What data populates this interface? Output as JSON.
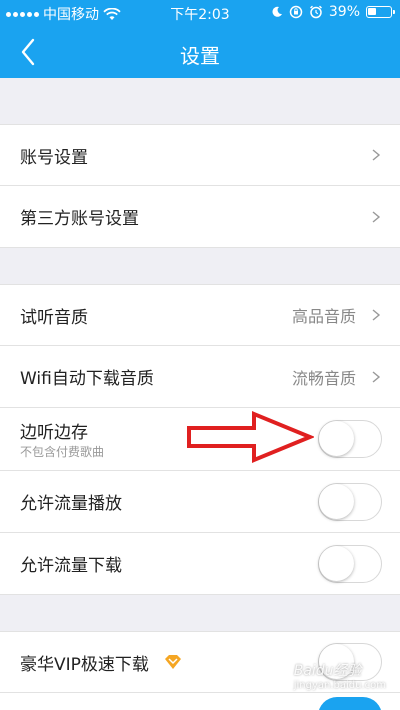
{
  "status_bar": {
    "carrier": "中国移动",
    "time": "下午2:03",
    "battery": "39%",
    "battery_level": 0.39
  },
  "nav": {
    "title": "设置",
    "back_icon": "chevron-left-icon"
  },
  "groups": [
    {
      "items": [
        {
          "label": "账号设置",
          "type": "link"
        },
        {
          "label": "第三方账号设置",
          "type": "link"
        }
      ]
    },
    {
      "items": [
        {
          "label": "试听音质",
          "value": "高品音质",
          "type": "link"
        },
        {
          "label": "Wifi自动下载音质",
          "value": "流畅音质",
          "type": "link"
        },
        {
          "label": "边听边存",
          "sublabel": "不包含付费歌曲",
          "type": "toggle",
          "on": false
        },
        {
          "label": "允许流量播放",
          "type": "toggle",
          "on": false
        },
        {
          "label": "允许流量下载",
          "type": "toggle",
          "on": false
        }
      ]
    },
    {
      "items": [
        {
          "label": "豪华VIP极速下载",
          "type": "toggle",
          "on": false,
          "badge": "vip-diamond-icon"
        }
      ]
    }
  ],
  "colors": {
    "accent": "#1aa3f0",
    "background": "#efeff4",
    "annotation_arrow": "#e02020",
    "vip_badge": "#f5a623"
  },
  "watermark": {
    "text": "Baidu经验",
    "sub": "jingyan.baidu.com"
  }
}
